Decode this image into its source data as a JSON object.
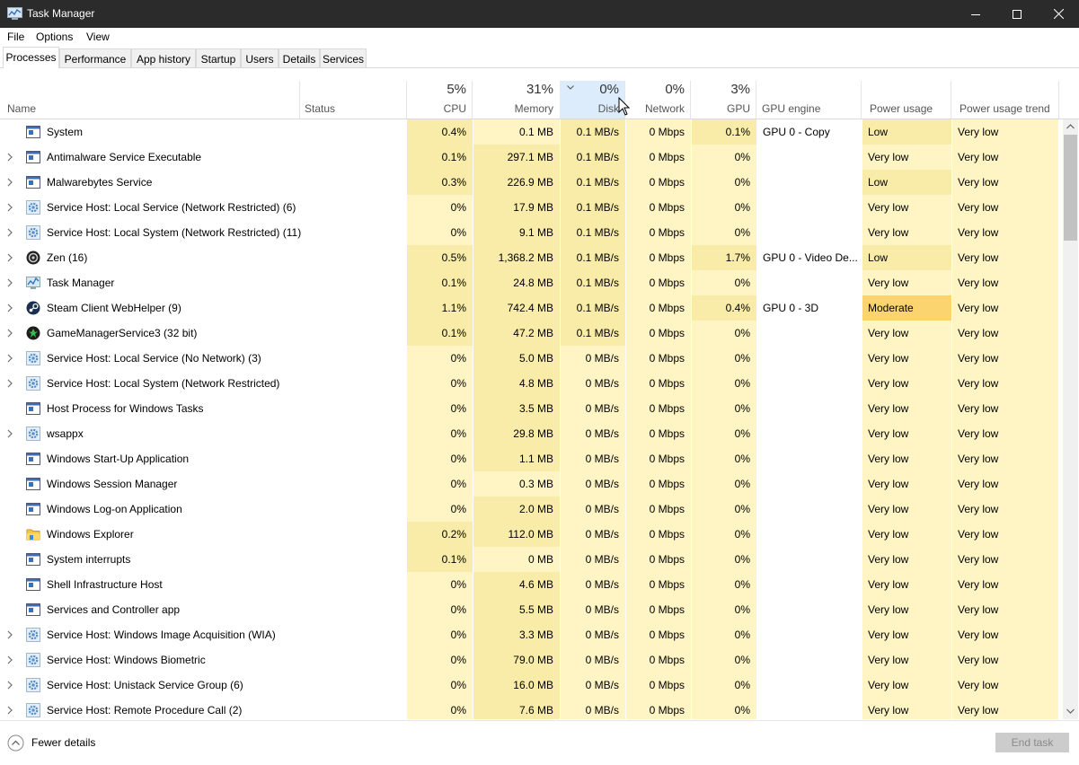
{
  "window": {
    "title": "Task Manager"
  },
  "menu": [
    "File",
    "Options",
    "View"
  ],
  "tabs": [
    "Processes",
    "Performance",
    "App history",
    "Startup",
    "Users",
    "Details",
    "Services"
  ],
  "columns": {
    "name": "Name",
    "status": "Status",
    "cpu": {
      "pct": "5%",
      "label": "CPU"
    },
    "memory": {
      "pct": "31%",
      "label": "Memory"
    },
    "disk": {
      "pct": "0%",
      "label": "Disk"
    },
    "network": {
      "pct": "0%",
      "label": "Network"
    },
    "gpu": {
      "pct": "3%",
      "label": "GPU"
    },
    "gpu_engine": "GPU engine",
    "power": "Power usage",
    "power_trend": "Power usage trend"
  },
  "colors": {
    "heat_light": "#fff4c4",
    "heat_mid": "#f9eca8",
    "heat_strong": "#f7e398",
    "power_moderate": "#fbd470",
    "sort_header": "#dcecfc"
  },
  "processes": [
    {
      "name": "System",
      "expand": false,
      "icon": "window",
      "cpu": "0.4%",
      "memory": "0.1 MB",
      "disk": "0.1 MB/s",
      "network": "0 Mbps",
      "gpu": "0.1%",
      "gpu_engine": "GPU 0 - Copy",
      "power": "Low",
      "trend": "Very low"
    },
    {
      "name": "Antimalware Service Executable",
      "expand": true,
      "icon": "window",
      "cpu": "0.1%",
      "memory": "297.1 MB",
      "disk": "0.1 MB/s",
      "network": "0 Mbps",
      "gpu": "0%",
      "gpu_engine": "",
      "power": "Very low",
      "trend": "Very low"
    },
    {
      "name": "Malwarebytes Service",
      "expand": true,
      "icon": "window",
      "cpu": "0.3%",
      "memory": "226.9 MB",
      "disk": "0.1 MB/s",
      "network": "0 Mbps",
      "gpu": "0%",
      "gpu_engine": "",
      "power": "Low",
      "trend": "Very low"
    },
    {
      "name": "Service Host: Local Service (Network Restricted) (6)",
      "expand": true,
      "icon": "gear",
      "cpu": "0%",
      "memory": "17.9 MB",
      "disk": "0.1 MB/s",
      "network": "0 Mbps",
      "gpu": "0%",
      "gpu_engine": "",
      "power": "Very low",
      "trend": "Very low"
    },
    {
      "name": "Service Host: Local System (Network Restricted) (11)",
      "expand": true,
      "icon": "gear",
      "cpu": "0%",
      "memory": "9.1 MB",
      "disk": "0.1 MB/s",
      "network": "0 Mbps",
      "gpu": "0%",
      "gpu_engine": "",
      "power": "Very low",
      "trend": "Very low"
    },
    {
      "name": "Zen (16)",
      "expand": true,
      "icon": "zen",
      "cpu": "0.5%",
      "memory": "1,368.2 MB",
      "disk": "0.1 MB/s",
      "network": "0 Mbps",
      "gpu": "1.7%",
      "gpu_engine": "GPU 0 - Video De...",
      "power": "Low",
      "trend": "Very low"
    },
    {
      "name": "Task Manager",
      "expand": true,
      "icon": "taskmgr",
      "cpu": "0.1%",
      "memory": "24.8 MB",
      "disk": "0.1 MB/s",
      "network": "0 Mbps",
      "gpu": "0%",
      "gpu_engine": "",
      "power": "Very low",
      "trend": "Very low"
    },
    {
      "name": "Steam Client WebHelper (9)",
      "expand": true,
      "icon": "steam",
      "cpu": "1.1%",
      "memory": "742.4 MB",
      "disk": "0.1 MB/s",
      "network": "0 Mbps",
      "gpu": "0.4%",
      "gpu_engine": "GPU 0 - 3D",
      "power": "Moderate",
      "trend": "Very low"
    },
    {
      "name": "GameManagerService3 (32 bit)",
      "expand": true,
      "icon": "greenbug",
      "cpu": "0.1%",
      "memory": "47.2 MB",
      "disk": "0.1 MB/s",
      "network": "0 Mbps",
      "gpu": "0%",
      "gpu_engine": "",
      "power": "Very low",
      "trend": "Very low"
    },
    {
      "name": "Service Host: Local Service (No Network) (3)",
      "expand": true,
      "icon": "gear",
      "cpu": "0%",
      "memory": "5.0 MB",
      "disk": "0 MB/s",
      "network": "0 Mbps",
      "gpu": "0%",
      "gpu_engine": "",
      "power": "Very low",
      "trend": "Very low"
    },
    {
      "name": "Service Host: Local System (Network Restricted)",
      "expand": true,
      "icon": "gear",
      "cpu": "0%",
      "memory": "4.8 MB",
      "disk": "0 MB/s",
      "network": "0 Mbps",
      "gpu": "0%",
      "gpu_engine": "",
      "power": "Very low",
      "trend": "Very low"
    },
    {
      "name": "Host Process for Windows Tasks",
      "expand": false,
      "icon": "window",
      "cpu": "0%",
      "memory": "3.5 MB",
      "disk": "0 MB/s",
      "network": "0 Mbps",
      "gpu": "0%",
      "gpu_engine": "",
      "power": "Very low",
      "trend": "Very low"
    },
    {
      "name": "wsappx",
      "expand": true,
      "icon": "gear",
      "cpu": "0%",
      "memory": "29.8 MB",
      "disk": "0 MB/s",
      "network": "0 Mbps",
      "gpu": "0%",
      "gpu_engine": "",
      "power": "Very low",
      "trend": "Very low"
    },
    {
      "name": "Windows Start-Up Application",
      "expand": false,
      "icon": "window",
      "cpu": "0%",
      "memory": "1.1 MB",
      "disk": "0 MB/s",
      "network": "0 Mbps",
      "gpu": "0%",
      "gpu_engine": "",
      "power": "Very low",
      "trend": "Very low"
    },
    {
      "name": "Windows Session Manager",
      "expand": false,
      "icon": "window",
      "cpu": "0%",
      "memory": "0.3 MB",
      "disk": "0 MB/s",
      "network": "0 Mbps",
      "gpu": "0%",
      "gpu_engine": "",
      "power": "Very low",
      "trend": "Very low"
    },
    {
      "name": "Windows Log-on Application",
      "expand": false,
      "icon": "window",
      "cpu": "0%",
      "memory": "2.0 MB",
      "disk": "0 MB/s",
      "network": "0 Mbps",
      "gpu": "0%",
      "gpu_engine": "",
      "power": "Very low",
      "trend": "Very low"
    },
    {
      "name": "Windows Explorer",
      "expand": false,
      "icon": "folder",
      "cpu": "0.2%",
      "memory": "112.0 MB",
      "disk": "0 MB/s",
      "network": "0 Mbps",
      "gpu": "0%",
      "gpu_engine": "",
      "power": "Very low",
      "trend": "Very low"
    },
    {
      "name": "System interrupts",
      "expand": false,
      "icon": "window",
      "cpu": "0.1%",
      "memory": "0 MB",
      "disk": "0 MB/s",
      "network": "0 Mbps",
      "gpu": "0%",
      "gpu_engine": "",
      "power": "Very low",
      "trend": "Very low"
    },
    {
      "name": "Shell Infrastructure Host",
      "expand": false,
      "icon": "window",
      "cpu": "0%",
      "memory": "4.6 MB",
      "disk": "0 MB/s",
      "network": "0 Mbps",
      "gpu": "0%",
      "gpu_engine": "",
      "power": "Very low",
      "trend": "Very low"
    },
    {
      "name": "Services and Controller app",
      "expand": false,
      "icon": "window",
      "cpu": "0%",
      "memory": "5.5 MB",
      "disk": "0 MB/s",
      "network": "0 Mbps",
      "gpu": "0%",
      "gpu_engine": "",
      "power": "Very low",
      "trend": "Very low"
    },
    {
      "name": "Service Host: Windows Image Acquisition (WIA)",
      "expand": true,
      "icon": "gear",
      "cpu": "0%",
      "memory": "3.3 MB",
      "disk": "0 MB/s",
      "network": "0 Mbps",
      "gpu": "0%",
      "gpu_engine": "",
      "power": "Very low",
      "trend": "Very low"
    },
    {
      "name": "Service Host: Windows Biometric",
      "expand": true,
      "icon": "gear",
      "cpu": "0%",
      "memory": "79.0 MB",
      "disk": "0 MB/s",
      "network": "0 Mbps",
      "gpu": "0%",
      "gpu_engine": "",
      "power": "Very low",
      "trend": "Very low"
    },
    {
      "name": "Service Host: Unistack Service Group (6)",
      "expand": true,
      "icon": "gear",
      "cpu": "0%",
      "memory": "16.0 MB",
      "disk": "0 MB/s",
      "network": "0 Mbps",
      "gpu": "0%",
      "gpu_engine": "",
      "power": "Very low",
      "trend": "Very low"
    },
    {
      "name": "Service Host: Remote Procedure Call (2)",
      "expand": true,
      "icon": "gear",
      "cpu": "0%",
      "memory": "7.6 MB",
      "disk": "0 MB/s",
      "network": "0 Mbps",
      "gpu": "0%",
      "gpu_engine": "",
      "power": "Very low",
      "trend": "Very low"
    }
  ],
  "footer": {
    "fewer_details": "Fewer details",
    "end_task": "End task"
  }
}
